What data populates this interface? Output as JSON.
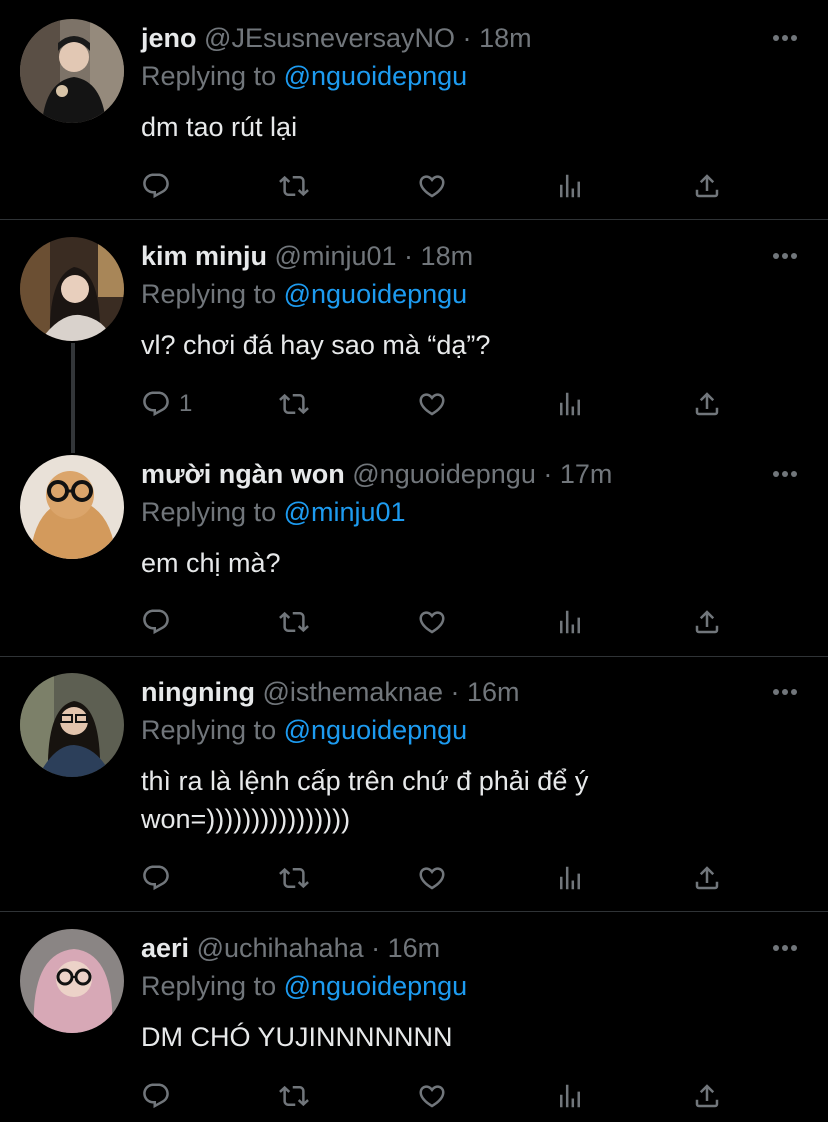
{
  "tweets": [
    {
      "name": "jeno",
      "handle": "@JEsusneversayNO",
      "sep": "·",
      "time": "18m",
      "reply_prefix": "Replying to",
      "reply_to": "@nguoidepngu",
      "text": "dm tao rút lại",
      "reply_count": ""
    },
    {
      "name": "kim minju",
      "handle": "@minju01",
      "sep": "·",
      "time": "18m",
      "reply_prefix": "Replying to",
      "reply_to": "@nguoidepngu",
      "text": "vl? chơi đá hay sao mà “dạ”?",
      "reply_count": "1"
    },
    {
      "name": "mười ngàn won",
      "handle": "@nguoidepngu",
      "sep": "·",
      "time": "17m",
      "reply_prefix": "Replying to",
      "reply_to": "@minju01",
      "text": "em chị mà?",
      "reply_count": ""
    },
    {
      "name": "ningning",
      "handle": "@isthemaknae",
      "sep": "·",
      "time": "16m",
      "reply_prefix": "Replying to",
      "reply_to": "@nguoidepngu",
      "text": "thì ra là lệnh cấp trên chứ đ phải để ý\nwon=))))))))))))))))",
      "reply_count": ""
    },
    {
      "name": "aeri",
      "handle": "@uchihahaha",
      "sep": "·",
      "time": "16m",
      "reply_prefix": "Replying to",
      "reply_to": "@nguoidepngu",
      "text": "DM CHÓ YUJINNNNNNN",
      "reply_count": ""
    }
  ],
  "colors": {
    "background": "#000000",
    "text": "#e7e9ea",
    "muted": "#71767b",
    "link": "#1d9bf0",
    "divider": "#2f3336"
  },
  "icons": [
    "reply-icon",
    "retweet-icon",
    "like-icon",
    "analytics-icon",
    "share-icon",
    "more-icon"
  ]
}
